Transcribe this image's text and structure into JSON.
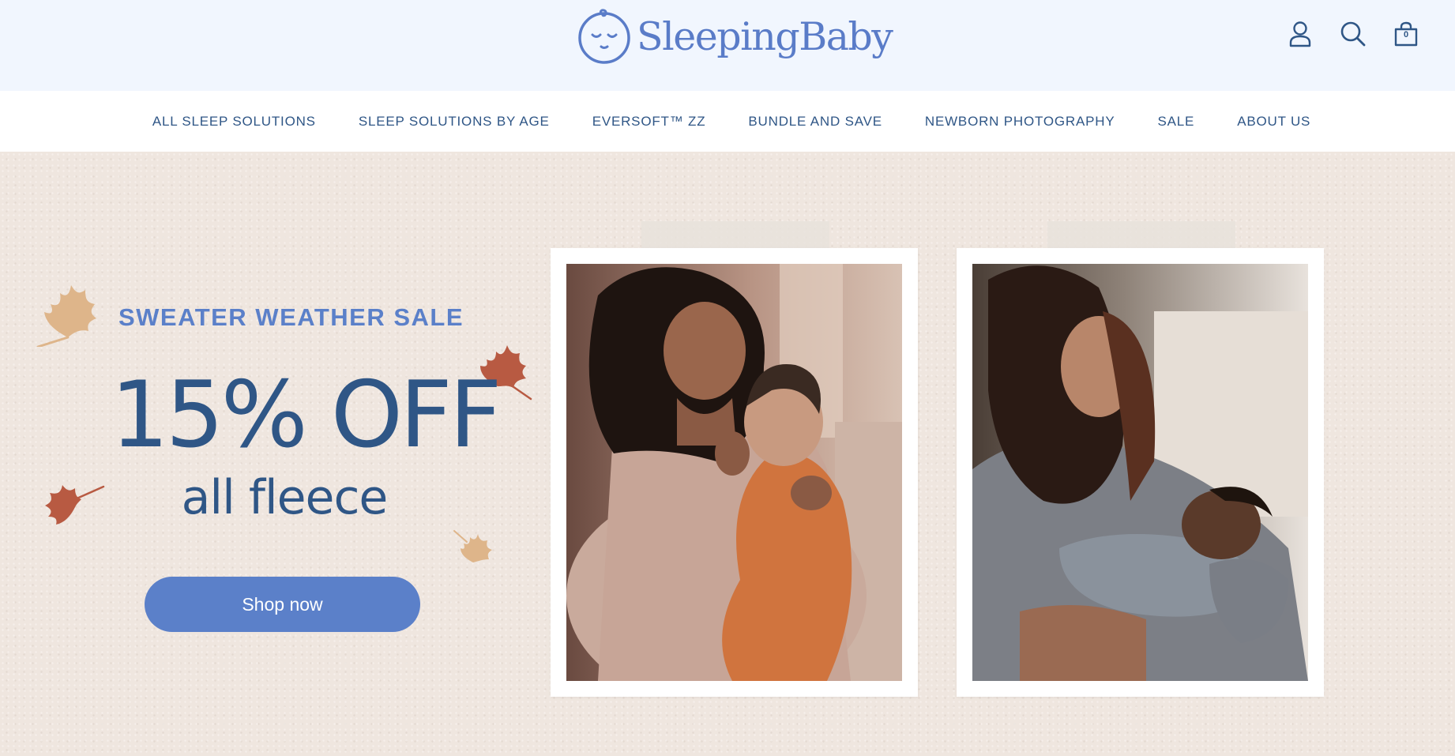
{
  "brand": {
    "name": "SleepingBaby",
    "logo_icon": "sleeping-baby-face-icon",
    "color": "#5a7cc8"
  },
  "header": {
    "icons": [
      {
        "name": "account-icon"
      },
      {
        "name": "search-icon"
      },
      {
        "name": "cart-icon",
        "count": "0"
      }
    ]
  },
  "nav": {
    "items": [
      "ALL SLEEP SOLUTIONS",
      "SLEEP SOLUTIONS BY AGE",
      "EVERSOFT™ ZZ",
      "BUNDLE AND SAVE",
      "NEWBORN PHOTOGRAPHY",
      "SALE",
      "ABOUT US"
    ]
  },
  "hero": {
    "eyebrow": "SWEATER WEATHER SALE",
    "headline": "15% OFF",
    "subline": "all fleece",
    "cta": "Shop now"
  },
  "colors": {
    "accent": "#5b80c9",
    "navy": "#2f5686",
    "header_bg": "#f1f6fe",
    "hero_bg": "#efe6df",
    "leaf_tan": "#deb58a",
    "leaf_rust": "#b85a42"
  }
}
